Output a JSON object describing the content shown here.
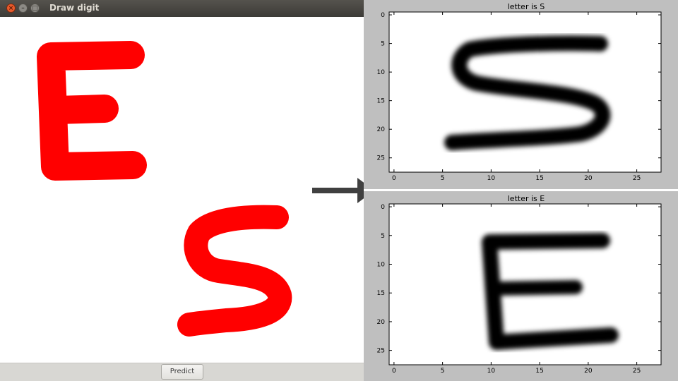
{
  "window": {
    "title": "Draw digit",
    "close_glyph": "×",
    "min_glyph": "–",
    "max_glyph": "□",
    "predict_label": "Predict"
  },
  "stroke_color": "#ff0000",
  "canvas_letters": [
    "E",
    "S"
  ],
  "plots": [
    {
      "title": "letter is S",
      "image_letter": "S",
      "x_ticks": [
        "0",
        "5",
        "10",
        "15",
        "20",
        "25"
      ],
      "y_ticks": [
        "0",
        "5",
        "10",
        "15",
        "20",
        "25"
      ]
    },
    {
      "title": "letter is E",
      "image_letter": "E",
      "x_ticks": [
        "0",
        "5",
        "10",
        "15",
        "20",
        "25"
      ],
      "y_ticks": [
        "0",
        "5",
        "10",
        "15",
        "20",
        "25"
      ]
    }
  ]
}
